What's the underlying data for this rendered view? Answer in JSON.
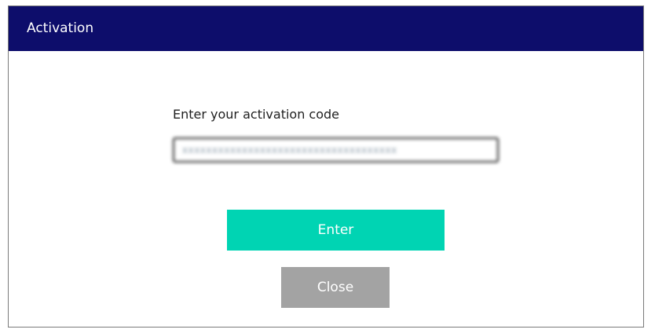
{
  "dialog": {
    "title": "Activation",
    "prompt": "Enter your activation code",
    "code_value": "xxxxxxxxxxxxxxxxxxxxxxxxxxxxxxxxxxxx",
    "enter_label": "Enter",
    "close_label": "Close"
  },
  "colors": {
    "titlebar": "#0d0d6b",
    "enter_button": "#00d4b3",
    "close_button": "#a3a3a3"
  }
}
